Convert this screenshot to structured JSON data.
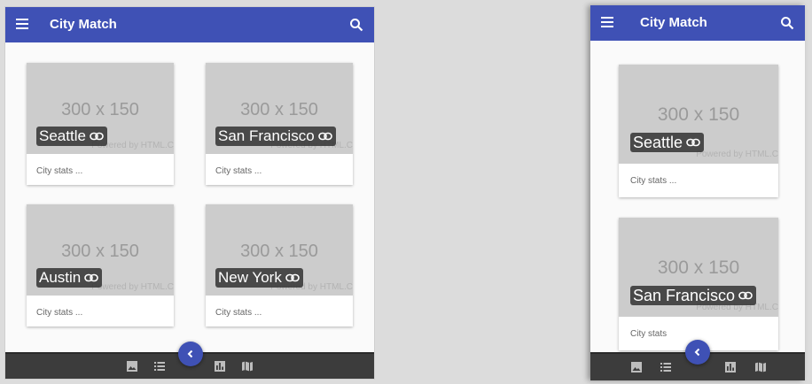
{
  "app": {
    "title": "City Match"
  },
  "placeholder_text": "300 x 150",
  "powered_text": "Powered by HTML.C",
  "stats_text": "City stats ...",
  "stats_text_truncated": "City stats",
  "cities": [
    "Seattle",
    "San Francisco",
    "Austin",
    "New York"
  ],
  "colors": {
    "primary": "#3f51b5",
    "bottom_bar": "#3c3c3c",
    "media": "#cccccc"
  },
  "bottom_nav_icons": [
    "image-icon",
    "list-icon",
    "chart-icon",
    "map-icon"
  ],
  "fab_icon": "chevron-left-icon"
}
